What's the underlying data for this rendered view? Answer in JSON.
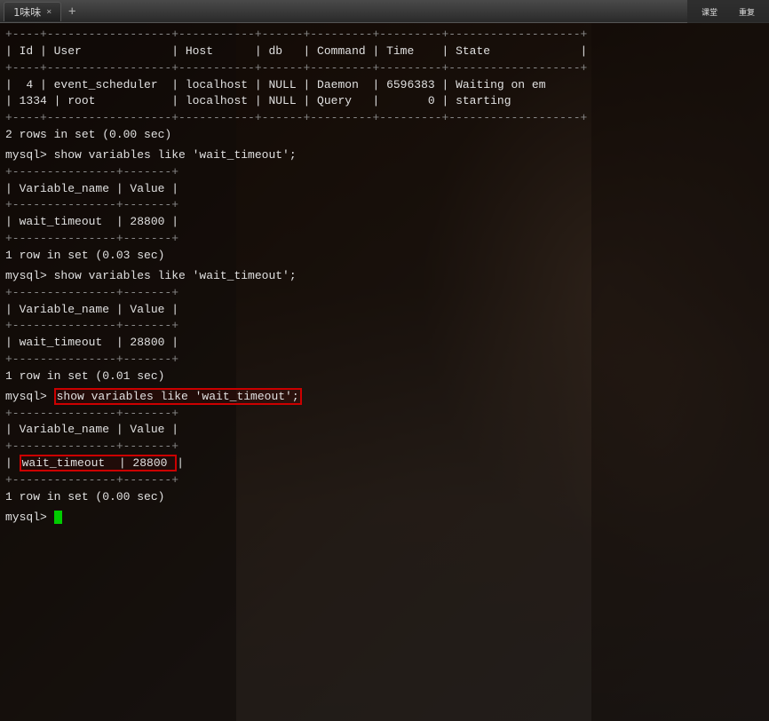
{
  "titlebar": {
    "tab_label": "1味味",
    "tab_close": "×",
    "tab_new": "+",
    "corner_minimize": "─",
    "corner_maximize": "□",
    "corner_close": "×"
  },
  "side_panel": {
    "label1": "课堂",
    "label2": "重复"
  },
  "terminal": {
    "separator1": "+----+------------------+-----------+------+---------+---------+-------------------+",
    "header_row": "| Id | User             | Host      | db   | Command | Time    | State             |",
    "separator2": "+----+------------------+-----------+------+---------+---------+-------------------+",
    "row1": "|  4 | event_scheduler  | localhost | NULL | Daemon  | 6596383 | Waiting on em",
    "row2": "| 1334 | root           | localhost | NULL | Query   |       0 | starting",
    "separator3": "+----+------------------+-----------+------+---------+---------+-------------------+",
    "result1": "2 rows in set (0.00 sec)",
    "blank1": "",
    "prompt1": "mysql> show variables like 'wait_timeout';",
    "sep_var1": "+---------------+-------+",
    "header_var1": "| Variable_name | Value |",
    "sep_var2": "+---------------+-------+",
    "wt_row1": "| wait_timeout  | 28800 |",
    "sep_var3": "+---------------+-------+",
    "result2": "1 row in set (0.03 sec)",
    "blank2": "",
    "prompt2": "mysql> show variables like 'wait_timeout';",
    "sep_var4": "+---------------+-------+",
    "header_var2": "| Variable_name | Value |",
    "sep_var5": "+---------------+-------+",
    "wt_row2": "| wait_timeout  | 28800 |",
    "sep_var6": "+---------------+-------+",
    "result3": "1 row in set (0.01 sec)",
    "blank3": "",
    "prompt3_pre": "mysql> ",
    "prompt3_cmd": "show variables like 'wait_timeout';",
    "sep_var7": "+---------------+-------+",
    "header_var3": "| Variable_name | Value |",
    "sep_var8": "+---------------+-------+",
    "wt_row3_pre": "| ",
    "wt_row3_val": "wait_timeout  | 28800 ",
    "wt_row3_post": "|",
    "sep_var9": "+---------------+-------+",
    "result4": "1 row in set (0.00 sec)",
    "blank4": "",
    "final_prompt": "mysql> "
  }
}
